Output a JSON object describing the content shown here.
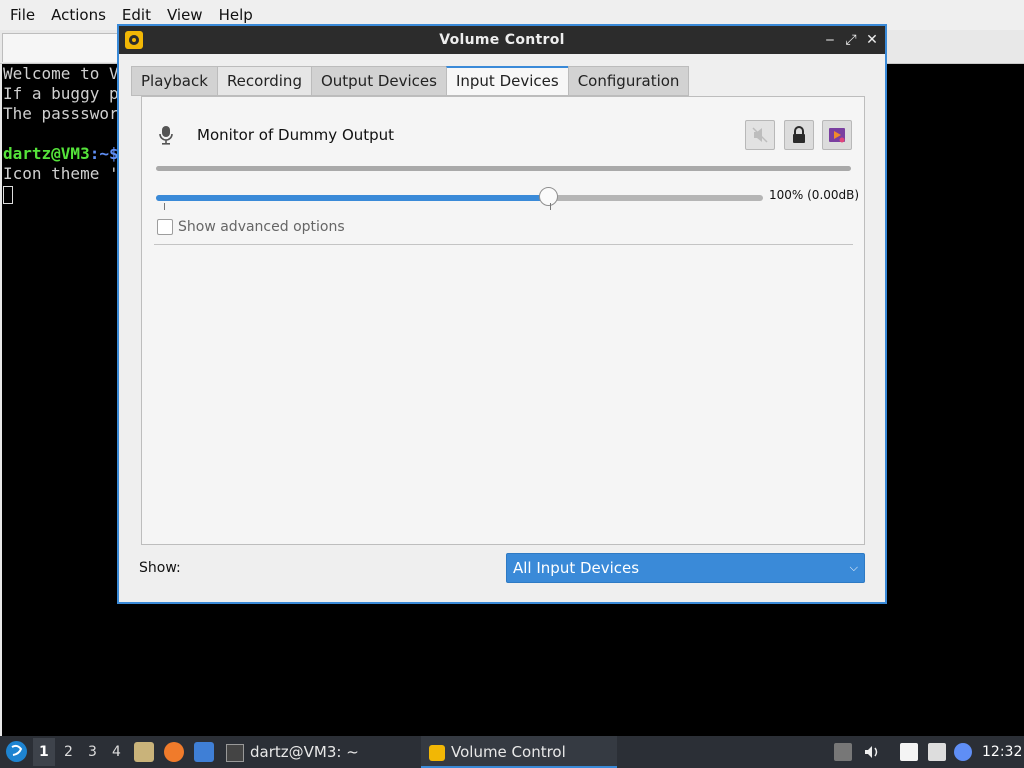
{
  "terminal": {
    "menu": [
      "File",
      "Actions",
      "Edit",
      "View",
      "Help"
    ],
    "lines": [
      "Welcome to V",
      "If a buggy p",
      "The passswor",
      "",
      "",
      "Icon theme '"
    ],
    "prompt_user": "dartz@VM3",
    "prompt_path": ":~$"
  },
  "dialog": {
    "title": "Volume Control",
    "window_controls": {
      "minimize": "‒",
      "maximize": "⤢",
      "close": "✕"
    },
    "tabs": [
      "Playback",
      "Recording",
      "Output Devices",
      "Input Devices",
      "Configuration"
    ],
    "active_tab": "Input Devices",
    "device": {
      "name": "Monitor of Dummy Output",
      "volume_percent": 100,
      "volume_fraction": 0.648,
      "volume_label": "100% (0.00dB)",
      "muted": false,
      "locked": true
    },
    "advanced": {
      "label": "Show advanced options",
      "checked": false
    },
    "show": {
      "label": "Show:",
      "value": "All Input Devices"
    }
  },
  "taskbar": {
    "workspaces": [
      "1",
      "2",
      "3",
      "4"
    ],
    "current_workspace": "1",
    "tasks": [
      {
        "label": "dartz@VM3: ~",
        "icon": "terminal-icon",
        "active": false
      },
      {
        "label": "Volume Control",
        "icon": "volume-control-icon",
        "active": true
      }
    ],
    "launchers": [
      "file-manager-icon",
      "firefox-icon",
      "desktop-icon"
    ],
    "tray": [
      "clipboard-icon",
      "volume-icon",
      "notes-icon",
      "network-icon",
      "update-icon"
    ],
    "clock": "12:32"
  },
  "colors": {
    "accent": "#3a8ad8",
    "titlebar": "#2c2c2c",
    "prompt_green": "#55e33a"
  }
}
